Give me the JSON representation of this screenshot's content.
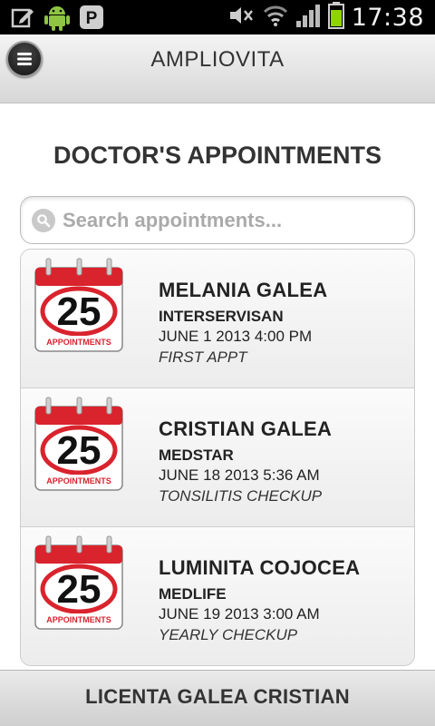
{
  "status_bar": {
    "time": "17:38",
    "left_icons": [
      "edit-icon",
      "android-icon",
      "pinterest-icon"
    ],
    "right_icons": [
      "mute-icon",
      "wifi-icon",
      "signal-icon",
      "battery-icon"
    ]
  },
  "header": {
    "title": "AMPLIOVITA",
    "menu_icon": "menu-icon"
  },
  "page": {
    "title": "DOCTOR'S APPOINTMENTS"
  },
  "search": {
    "placeholder": "Search appointments...",
    "value": ""
  },
  "calendar_icon": {
    "number": "25",
    "label": "APPOINTMENTS"
  },
  "appointments": [
    {
      "name": "MELANIA GALEA",
      "clinic": "INTERSERVISAN",
      "date": "JUNE 1 2013 4:00 PM",
      "note": "FIRST APPT"
    },
    {
      "name": "CRISTIAN GALEA",
      "clinic": "MEDSTAR",
      "date": "JUNE 18 2013 5:36 AM",
      "note": "TONSILITIS CHECKUP"
    },
    {
      "name": "LUMINITA COJOCEA",
      "clinic": "MEDLIFE",
      "date": "JUNE 19 2013 3:00 AM",
      "note": "YEARLY CHECKUP"
    }
  ],
  "footer": {
    "title": "LICENTA GALEA CRISTIAN"
  },
  "colors": {
    "calendar_red": "#d9232d",
    "header_bg": "#e6e6e6",
    "text_dark": "#333333"
  }
}
